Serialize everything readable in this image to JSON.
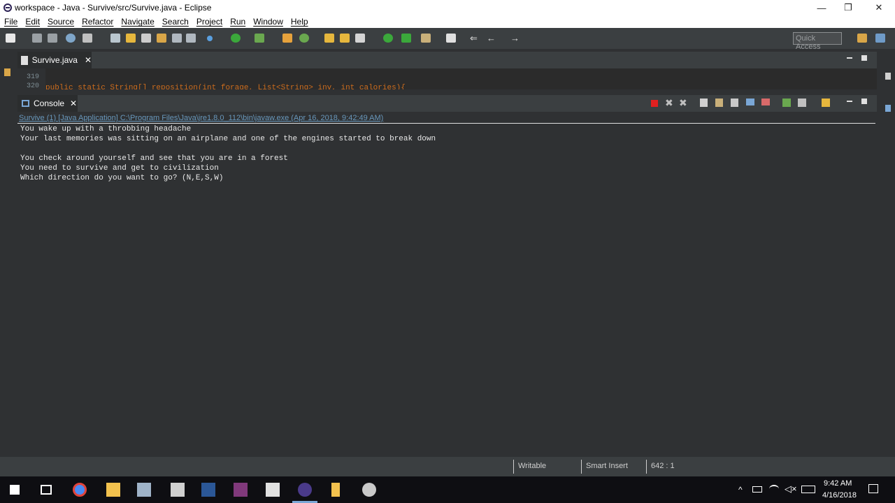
{
  "window": {
    "title": "workspace - Java - Survive/src/Survive.java - Eclipse",
    "minimize_glyph": "—",
    "restore_glyph": "❐",
    "close_glyph": "✕"
  },
  "menu": [
    "File",
    "Edit",
    "Source",
    "Refactor",
    "Navigate",
    "Search",
    "Project",
    "Run",
    "Window",
    "Help"
  ],
  "toolbar": {
    "quick_access_placeholder": "Quick Access"
  },
  "editor": {
    "tab_label": "Survive.java",
    "close_glyph": "✕",
    "line_numbers": [
      "319",
      "320"
    ],
    "code_peek": "public static String[] reposition(int forage, List<String> inv, int calories){"
  },
  "console": {
    "tab_label": "Console",
    "close_glyph": "✕",
    "header": "Survive (1) [Java Application] C:\\Program Files\\Java\\jre1.8.0_112\\bin\\javaw.exe (Apr 16, 2018, 9:42:49 AM)",
    "lines": [
      "You wake up with a throbbing headache",
      "Your last memories was sitting on an airplane and one of the engines started to break down",
      "",
      "You check around yourself and see that you are in a forest",
      "You need to survive and get to civilization",
      "Which direction do you want to go? (N,E,S,W)"
    ]
  },
  "status": {
    "writable": "Writable",
    "insert_mode": "Smart Insert",
    "position": "642 : 1"
  },
  "taskbar": {
    "time": "9:42 AM",
    "date": "4/16/2018"
  },
  "colors": {
    "console_header": "#6897bb",
    "stop_button": "#e02020",
    "run_button": "#3ba83b"
  }
}
